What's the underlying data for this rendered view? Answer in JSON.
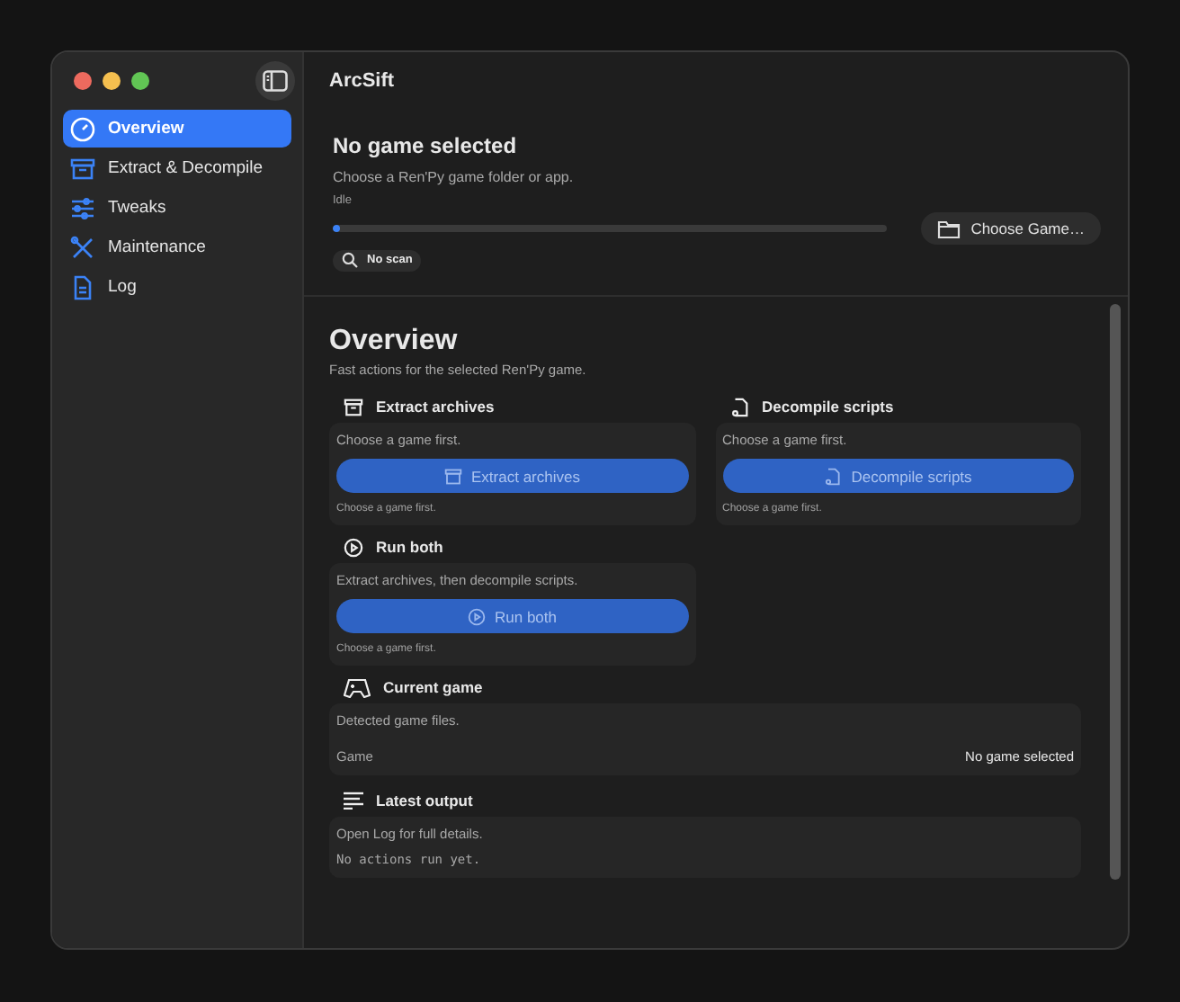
{
  "window": {
    "title": "ArcSift"
  },
  "sidebar": {
    "items": [
      {
        "label": "Overview",
        "selected": true
      },
      {
        "label": "Extract & Decompile",
        "selected": false
      },
      {
        "label": "Tweaks",
        "selected": false
      },
      {
        "label": "Maintenance",
        "selected": false
      },
      {
        "label": "Log",
        "selected": false
      }
    ]
  },
  "header": {
    "title": "No game selected",
    "subtitle": "Choose a Ren'Py game folder or app.",
    "status": "Idle",
    "progress": {
      "level": 0.01
    },
    "scan_badge": "No scan",
    "choose_button": "Choose Game…"
  },
  "overview": {
    "title": "Overview",
    "subtitle": "Fast actions for the selected Ren'Py game."
  },
  "actions": [
    {
      "title": "Extract archives",
      "description": "Choose a game first.",
      "button": "Extract archives",
      "note": "Choose a game first."
    },
    {
      "title": "Decompile scripts",
      "description": "Choose a game first.",
      "button": "Decompile scripts",
      "note": "Choose a game first."
    },
    {
      "title": "Run both",
      "description": "Extract archives, then decompile scripts.",
      "button": "Run both",
      "note": "Choose a game first."
    }
  ],
  "current_game": {
    "title": "Current game",
    "description": "Detected game files.",
    "rows": [
      {
        "label": "Game",
        "value": "No game selected"
      }
    ]
  },
  "latest_output": {
    "title": "Latest output",
    "description": "Open Log for full details.",
    "text": "No actions run yet."
  }
}
